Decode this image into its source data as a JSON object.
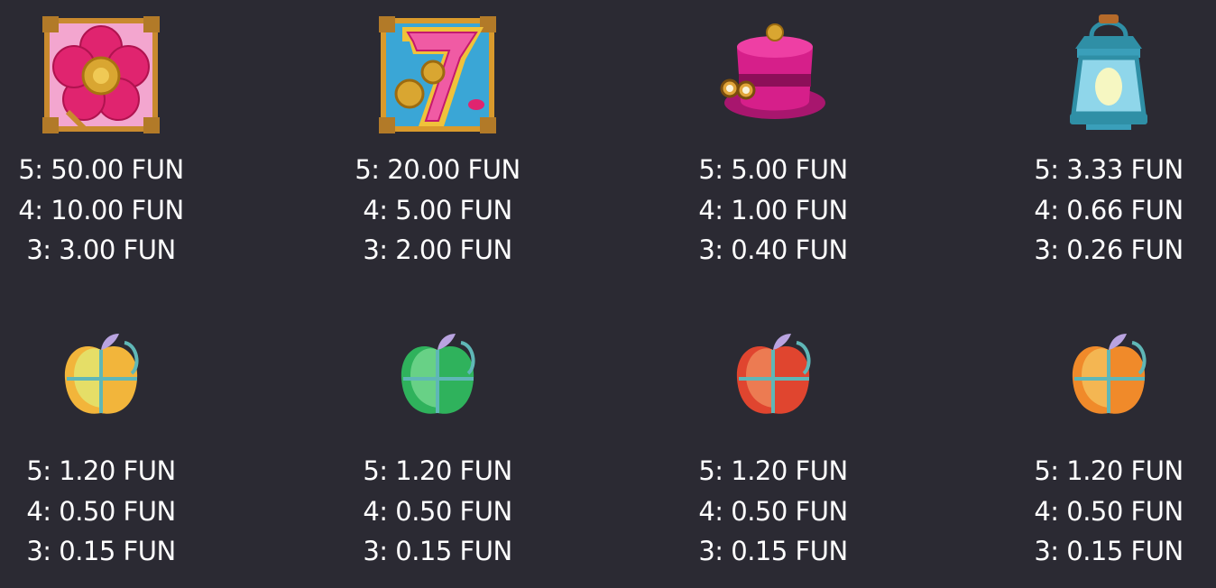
{
  "colors": {
    "background": "#2b2a33",
    "text": "#ffffff"
  },
  "symbols": [
    {
      "icon": "flower-gear-icon",
      "pays": [
        "5: 50.00 FUN",
        "4: 10.00 FUN",
        "3: 3.00 FUN"
      ]
    },
    {
      "icon": "seven-gear-icon",
      "pays": [
        "5: 20.00 FUN",
        "4: 5.00 FUN",
        "3: 2.00 FUN"
      ]
    },
    {
      "icon": "top-hat-icon",
      "pays": [
        "5: 5.00 FUN",
        "4: 1.00 FUN",
        "3: 0.40 FUN"
      ]
    },
    {
      "icon": "lantern-icon",
      "pays": [
        "5: 3.33 FUN",
        "4: 0.66 FUN",
        "3: 0.26 FUN"
      ]
    },
    {
      "icon": "yellow-apple-icon",
      "pays": [
        "5: 1.20 FUN",
        "4: 0.50 FUN",
        "3: 0.15 FUN"
      ]
    },
    {
      "icon": "green-apple-icon",
      "pays": [
        "5: 1.20 FUN",
        "4: 0.50 FUN",
        "3: 0.15 FUN"
      ]
    },
    {
      "icon": "red-apple-icon",
      "pays": [
        "5: 1.20 FUN",
        "4: 0.50 FUN",
        "3: 0.15 FUN"
      ]
    },
    {
      "icon": "orange-apple-icon",
      "pays": [
        "5: 1.20 FUN",
        "4: 0.50 FUN",
        "3: 0.15 FUN"
      ]
    }
  ]
}
